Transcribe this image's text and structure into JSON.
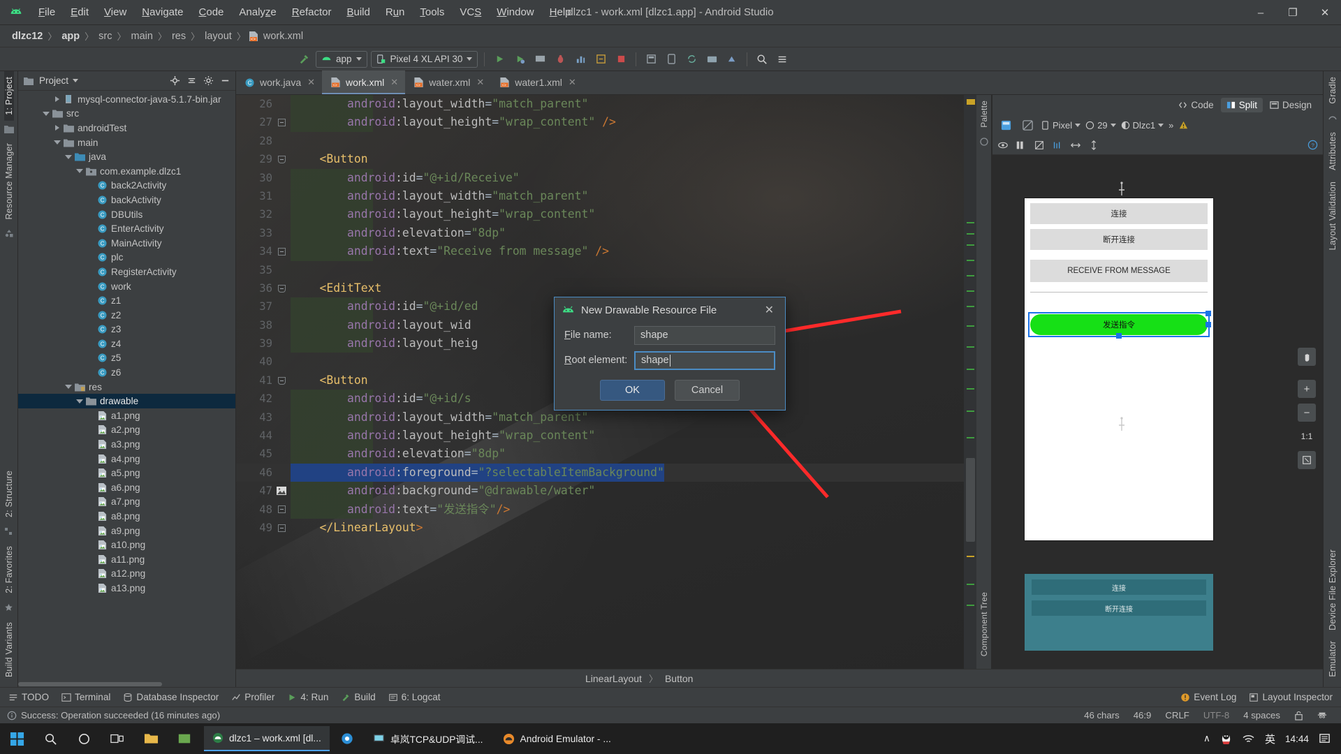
{
  "window": {
    "title": "dlzc1 - work.xml [dlzc1.app] - Android Studio",
    "minimize": "–",
    "maximize": "❐",
    "close": "✕"
  },
  "menu": [
    "File",
    "Edit",
    "View",
    "Navigate",
    "Code",
    "Analyze",
    "Refactor",
    "Build",
    "Run",
    "Tools",
    "VCS",
    "Window",
    "Help"
  ],
  "breadcrumb": {
    "items": [
      "dlzc12",
      "app",
      "src",
      "main",
      "res",
      "layout"
    ],
    "file": "work.xml",
    "separator": "〉"
  },
  "toolbar": {
    "app_config": "app",
    "device": "Pixel 4 XL API 30",
    "caret": "▾"
  },
  "editor_tabs": [
    {
      "label": "work.java",
      "type": "java",
      "active": false
    },
    {
      "label": "work.xml",
      "type": "xml",
      "active": true
    },
    {
      "label": "water.xml",
      "type": "xml",
      "active": false
    },
    {
      "label": "water1.xml",
      "type": "xml",
      "active": false
    }
  ],
  "view_modes": [
    {
      "label": "Code",
      "active": false
    },
    {
      "label": "Split",
      "active": true
    },
    {
      "label": "Design",
      "active": false
    }
  ],
  "project_panel": {
    "title": "Project",
    "caret": "▾",
    "tree": [
      {
        "indent": 3,
        "twisty": "right",
        "icon": "jar",
        "label": "mysql-connector-java-5.1.7-bin.jar",
        "selected": false
      },
      {
        "indent": 2,
        "twisty": "down",
        "icon": "folder",
        "label": "src",
        "selected": false
      },
      {
        "indent": 3,
        "twisty": "right",
        "icon": "folder",
        "label": "androidTest",
        "selected": false
      },
      {
        "indent": 3,
        "twisty": "down",
        "icon": "folder",
        "label": "main",
        "selected": false
      },
      {
        "indent": 4,
        "twisty": "down",
        "icon": "folder-blue",
        "label": "java",
        "selected": false
      },
      {
        "indent": 5,
        "twisty": "down",
        "icon": "package",
        "label": "com.example.dlzc1",
        "selected": false
      },
      {
        "indent": 6,
        "twisty": "none",
        "icon": "class",
        "label": "back2Activity",
        "selected": false
      },
      {
        "indent": 6,
        "twisty": "none",
        "icon": "class",
        "label": "backActivity",
        "selected": false
      },
      {
        "indent": 6,
        "twisty": "none",
        "icon": "class",
        "label": "DBUtils",
        "selected": false
      },
      {
        "indent": 6,
        "twisty": "none",
        "icon": "class",
        "label": "EnterActivity",
        "selected": false
      },
      {
        "indent": 6,
        "twisty": "none",
        "icon": "class",
        "label": "MainActivity",
        "selected": false
      },
      {
        "indent": 6,
        "twisty": "none",
        "icon": "class",
        "label": "plc",
        "selected": false
      },
      {
        "indent": 6,
        "twisty": "none",
        "icon": "class",
        "label": "RegisterActivity",
        "selected": false
      },
      {
        "indent": 6,
        "twisty": "none",
        "icon": "class",
        "label": "work",
        "selected": false
      },
      {
        "indent": 6,
        "twisty": "none",
        "icon": "class",
        "label": "z1",
        "selected": false
      },
      {
        "indent": 6,
        "twisty": "none",
        "icon": "class",
        "label": "z2",
        "selected": false
      },
      {
        "indent": 6,
        "twisty": "none",
        "icon": "class",
        "label": "z3",
        "selected": false
      },
      {
        "indent": 6,
        "twisty": "none",
        "icon": "class",
        "label": "z4",
        "selected": false
      },
      {
        "indent": 6,
        "twisty": "none",
        "icon": "class",
        "label": "z5",
        "selected": false
      },
      {
        "indent": 6,
        "twisty": "none",
        "icon": "class",
        "label": "z6",
        "selected": false
      },
      {
        "indent": 4,
        "twisty": "down",
        "icon": "folder-res",
        "label": "res",
        "selected": false
      },
      {
        "indent": 5,
        "twisty": "down",
        "icon": "folder",
        "label": "drawable",
        "selected": true
      },
      {
        "indent": 6,
        "twisty": "none",
        "icon": "png",
        "label": "a1.png",
        "selected": false
      },
      {
        "indent": 6,
        "twisty": "none",
        "icon": "png",
        "label": "a2.png",
        "selected": false
      },
      {
        "indent": 6,
        "twisty": "none",
        "icon": "png",
        "label": "a3.png",
        "selected": false
      },
      {
        "indent": 6,
        "twisty": "none",
        "icon": "png",
        "label": "a4.png",
        "selected": false
      },
      {
        "indent": 6,
        "twisty": "none",
        "icon": "png",
        "label": "a5.png",
        "selected": false
      },
      {
        "indent": 6,
        "twisty": "none",
        "icon": "png",
        "label": "a6.png",
        "selected": false
      },
      {
        "indent": 6,
        "twisty": "none",
        "icon": "png",
        "label": "a7.png",
        "selected": false
      },
      {
        "indent": 6,
        "twisty": "none",
        "icon": "png",
        "label": "a8.png",
        "selected": false
      },
      {
        "indent": 6,
        "twisty": "none",
        "icon": "png",
        "label": "a9.png",
        "selected": false
      },
      {
        "indent": 6,
        "twisty": "none",
        "icon": "png",
        "label": "a10.png",
        "selected": false
      },
      {
        "indent": 6,
        "twisty": "none",
        "icon": "png",
        "label": "a11.png",
        "selected": false
      },
      {
        "indent": 6,
        "twisty": "none",
        "icon": "png",
        "label": "a12.png",
        "selected": false
      },
      {
        "indent": 6,
        "twisty": "none",
        "icon": "png",
        "label": "a13.png",
        "selected": false
      }
    ]
  },
  "left_rail": [
    "1: Project",
    "Resource Manager"
  ],
  "left_rail_bottom": [
    "2: Structure",
    "2: Favorites",
    "Build Variants"
  ],
  "right_rail": [
    "Gradle",
    "Attributes",
    "Layout Validation"
  ],
  "right_rail_bottom": [
    "Device File Explorer",
    "Emulator"
  ],
  "code": {
    "first_line": 26,
    "highlight_line": 46,
    "lines": [
      {
        "n": 26,
        "fold": "none",
        "text": "        android:layout_width=\"match_parent\""
      },
      {
        "n": 27,
        "fold": "end",
        "text": "        android:layout_height=\"wrap_content\" />"
      },
      {
        "n": 28,
        "fold": "none",
        "text": ""
      },
      {
        "n": 29,
        "fold": "start",
        "text": "    <Button"
      },
      {
        "n": 30,
        "fold": "none",
        "text": "        android:id=\"@+id/Receive\""
      },
      {
        "n": 31,
        "fold": "none",
        "text": "        android:layout_width=\"match_parent\""
      },
      {
        "n": 32,
        "fold": "none",
        "text": "        android:layout_height=\"wrap_content\""
      },
      {
        "n": 33,
        "fold": "none",
        "text": "        android:elevation=\"8dp\""
      },
      {
        "n": 34,
        "fold": "end",
        "text": "        android:text=\"Receive from message\" />"
      },
      {
        "n": 35,
        "fold": "none",
        "text": ""
      },
      {
        "n": 36,
        "fold": "start",
        "text": "    <EditText"
      },
      {
        "n": 37,
        "fold": "none",
        "text": "        android:id=\"@+id/ed"
      },
      {
        "n": 38,
        "fold": "none",
        "text": "        android:layout_wid"
      },
      {
        "n": 39,
        "fold": "none",
        "text": "        android:layout_heig"
      },
      {
        "n": 40,
        "fold": "none",
        "text": ""
      },
      {
        "n": 41,
        "fold": "start",
        "text": "    <Button"
      },
      {
        "n": 42,
        "fold": "none",
        "text": "        android:id=\"@+id/s"
      },
      {
        "n": 43,
        "fold": "none",
        "text": "        android:layout_width=\"match_parent\""
      },
      {
        "n": 44,
        "fold": "none",
        "text": "        android:layout_height=\"wrap_content\""
      },
      {
        "n": 45,
        "fold": "none",
        "text": "        android:elevation=\"8dp\""
      },
      {
        "n": 46,
        "fold": "none",
        "text": "        android:foreground=\"?selectableItemBackground\""
      },
      {
        "n": 47,
        "fold": "image",
        "text": "        android:background=\"@drawable/water\""
      },
      {
        "n": 48,
        "fold": "end",
        "text": "        android:text=\"发送指令\"/>"
      },
      {
        "n": 49,
        "fold": "end",
        "text": "    </LinearLayout>"
      }
    ]
  },
  "design": {
    "device_label": "Pixel",
    "api_label": "29",
    "theme_label": "Dlzc1",
    "overflow": "»",
    "zoom_label": "1:1",
    "plus": "+",
    "minus": "−",
    "preview_buttons": [
      "连接",
      "断开连接",
      "RECEIVE FROM MESSAGE"
    ],
    "send_button": "发送指令",
    "mini_buttons": [
      "连接",
      "断开连接"
    ],
    "palette_label": "Palette",
    "component_tree_label": "Component Tree"
  },
  "bottom_breadcrumb": {
    "parent": "LinearLayout",
    "child": "Button",
    "sep": "〉"
  },
  "tool_windows": [
    {
      "label": "TODO",
      "icon": "todo-icon"
    },
    {
      "label": "Terminal",
      "icon": "terminal-icon"
    },
    {
      "label": "Database Inspector",
      "icon": "database-icon"
    },
    {
      "label": "Profiler",
      "icon": "profiler-icon"
    },
    {
      "label": "4: Run",
      "icon": "run-icon"
    },
    {
      "label": "Build",
      "icon": "build-icon"
    },
    {
      "label": "6: Logcat",
      "icon": "logcat-icon"
    }
  ],
  "tool_windows_right": [
    {
      "label": "Event Log",
      "icon": "event-log-icon"
    },
    {
      "label": "Layout Inspector",
      "icon": "layout-inspector-icon"
    }
  ],
  "status_bar": {
    "message": "Success: Operation succeeded (16 minutes ago)",
    "chars": "46 chars",
    "caret_pos": "46:9",
    "line_sep": "CRLF",
    "encoding": "UTF-8",
    "indent": "4 spaces"
  },
  "dialog": {
    "title": "New Drawable Resource File",
    "close": "✕",
    "fields": [
      {
        "label": "File name:",
        "label_mnemonic": "F",
        "value": "shape",
        "focused": false
      },
      {
        "label": "Root element:",
        "label_mnemonic": "R",
        "value": "shape",
        "focused": true
      }
    ],
    "ok": "OK",
    "cancel": "Cancel"
  },
  "taskbar": {
    "apps": [
      {
        "label": "dlzc1 – work.xml [dl...",
        "active": true,
        "icon": "android-studio-icon"
      },
      {
        "label": "卓岚TCP&UDP调试...",
        "active": false,
        "icon": "tcp-tool-icon"
      },
      {
        "label": "Android Emulator - ...",
        "active": false,
        "icon": "emulator-icon"
      }
    ],
    "tray": {
      "chevron": "∧",
      "ime": "英",
      "time": "14:44"
    }
  },
  "colors": {
    "accent_blue": "#4b8cc4",
    "primary_button": "#365880",
    "selection": "#0d293e",
    "annotation_red": "#ff2a2a",
    "green": "#16e016"
  }
}
